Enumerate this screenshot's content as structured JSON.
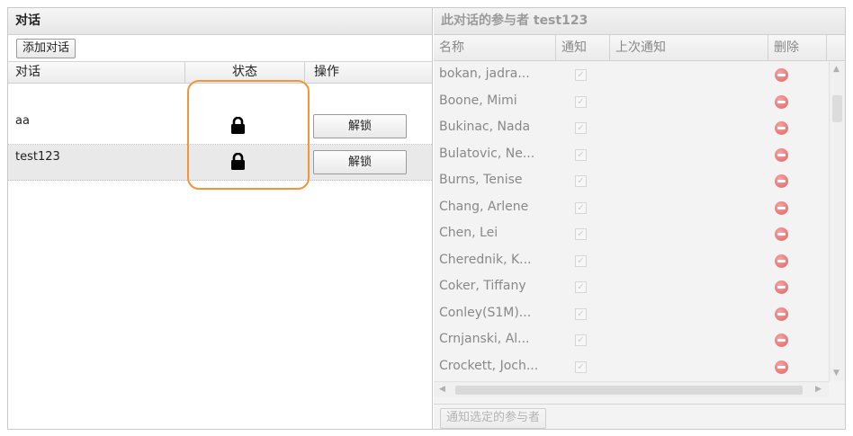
{
  "left_panel": {
    "title": "对话",
    "add_button": "添加对话",
    "columns": {
      "conversation": "对话",
      "status": "状态",
      "action": "操作"
    },
    "rows": [
      {
        "name": "aa",
        "status_icon": "lock-icon",
        "action": "解锁"
      },
      {
        "name": "test123",
        "status_icon": "lock-icon",
        "action": "解锁"
      }
    ]
  },
  "right_panel": {
    "title": "此对话的参与者 test123",
    "columns": {
      "name": "名称",
      "notify": "通知",
      "last_notify": "上次通知",
      "delete": "删除"
    },
    "participants": [
      {
        "name": "bokan, jadra..."
      },
      {
        "name": "Boone, Mimi"
      },
      {
        "name": "Bukinac, Nada"
      },
      {
        "name": "Bulatovic, Ne..."
      },
      {
        "name": "Burns, Tenise"
      },
      {
        "name": "Chang, Arlene"
      },
      {
        "name": "Chen, Lei"
      },
      {
        "name": "Cherednik, K..."
      },
      {
        "name": "Coker, Tiffany"
      },
      {
        "name": "Conley(S1M)..."
      },
      {
        "name": "Crnjanski, Al..."
      },
      {
        "name": "Crockett, Joch..."
      }
    ],
    "notify_button": "通知选定的参与者"
  },
  "colors": {
    "highlight": "#f0953a",
    "delete_icon": "#e06060"
  }
}
